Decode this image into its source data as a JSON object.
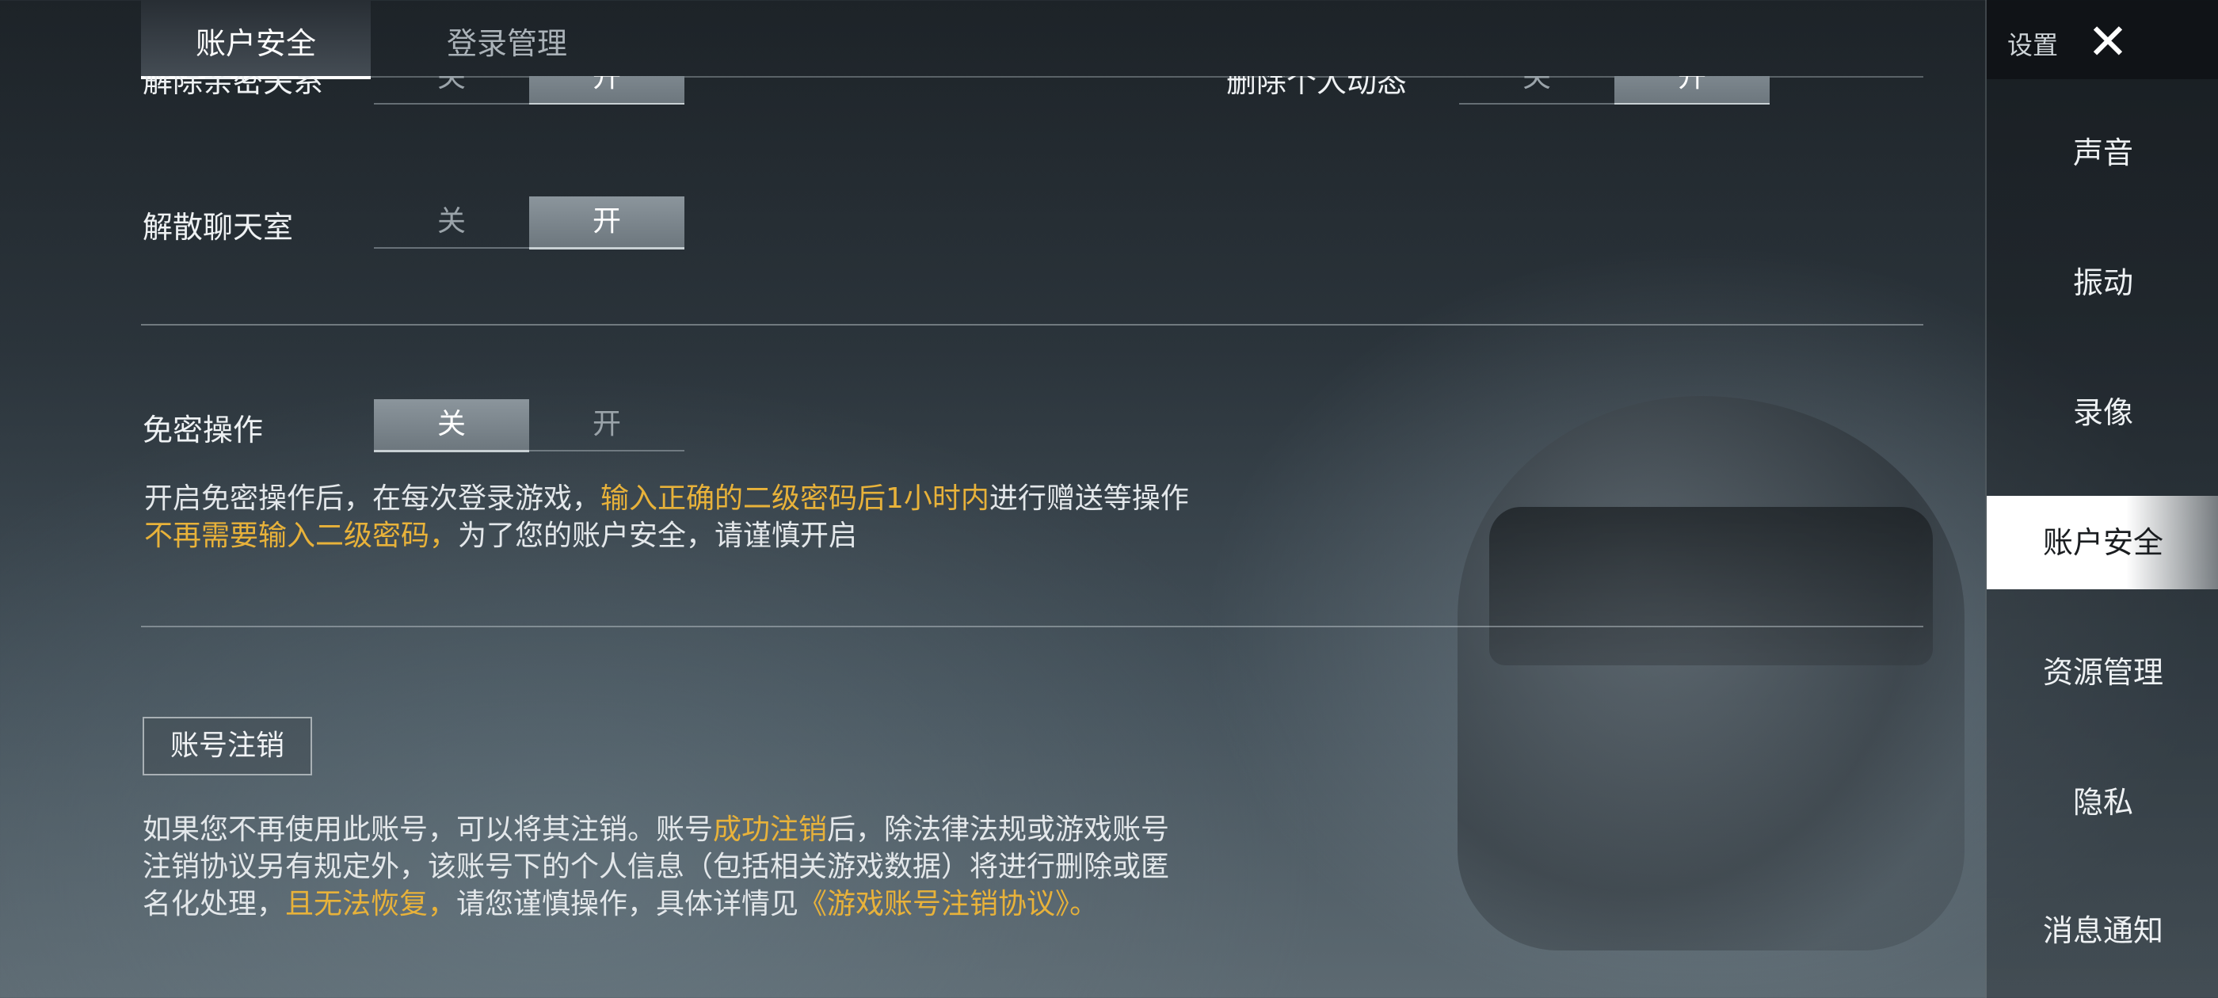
{
  "tabs": [
    {
      "label": "账户安全",
      "active": true
    },
    {
      "label": "登录管理",
      "active": false
    }
  ],
  "sidebar": {
    "title": "设置",
    "close_icon": "close-icon",
    "items": [
      {
        "label": "声音"
      },
      {
        "label": "振动"
      },
      {
        "label": "录像"
      },
      {
        "label": "账户安全",
        "active": true
      },
      {
        "label": "资源管理"
      },
      {
        "label": "隐私"
      },
      {
        "label": "消息通知"
      }
    ]
  },
  "settings": {
    "row1_left": {
      "label": "解除亲密关系",
      "off": "关",
      "on": "开",
      "selected": "on"
    },
    "row1_right": {
      "label": "删除个人动态",
      "off": "关",
      "on": "开",
      "selected": "on"
    },
    "dissolve_chat": {
      "label": "解散聊天室",
      "off": "关",
      "on": "开",
      "selected": "on"
    },
    "password_free": {
      "label": "免密操作",
      "off": "关",
      "on": "开",
      "selected": "off"
    }
  },
  "password_free_desc": {
    "line1_a": "开启免密操作后，在每次登录游戏，",
    "line1_hl": "输入正确的二级密码后1小时内",
    "line1_b": "进行赠送等操作",
    "line2_hl": "不再需要输入二级密码，",
    "line2_b": "为了您的账户安全，请谨慎开启"
  },
  "account_cancel": {
    "button_label": "账号注销",
    "line1_a": "如果您不再使用此账号，可以将其注销。账号",
    "line1_hl": "成功注销",
    "line1_b": "后，除法律法规或游戏账号",
    "line2": "注销协议另有规定外，该账号下的个人信息（包括相关游戏数据）将进行删除或匿",
    "line3_a": "名化处理，",
    "line3_hl": "且无法恢复，",
    "line3_b": "请您谨慎操作，具体详情见",
    "line3_link": "《游戏账号注销协议》",
    "line3_end": "。"
  },
  "colors": {
    "highlight": "#e8b23a",
    "active_tab_underline": "#ffffff"
  }
}
